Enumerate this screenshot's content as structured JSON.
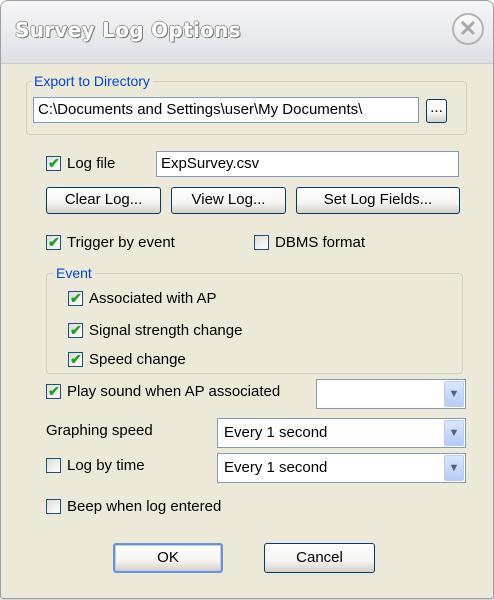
{
  "window": {
    "title": "Survey Log Options",
    "close_glyph": "✕"
  },
  "export": {
    "legend": "Export to Directory",
    "path": "C:\\Documents and Settings\\user\\My Documents\\",
    "browse_label": "..."
  },
  "log": {
    "log_file_label": "Log file",
    "log_file_checked": true,
    "file_name": "ExpSurvey.csv",
    "clear_label": "Clear Log...",
    "view_label": "View Log...",
    "fields_label": "Set Log Fields..."
  },
  "trigger": {
    "label": "Trigger by event",
    "checked": true
  },
  "dbms": {
    "label": "DBMS format",
    "checked": false
  },
  "event": {
    "legend": "Event",
    "items": [
      {
        "label": "Associated with AP",
        "checked": true
      },
      {
        "label": "Signal strength change",
        "checked": true
      },
      {
        "label": "Speed change",
        "checked": true
      }
    ]
  },
  "sound": {
    "label": "Play sound when AP associated",
    "checked": true,
    "value": ""
  },
  "graphing": {
    "label": "Graphing speed",
    "value": "Every 1 second"
  },
  "logtime": {
    "label": "Log by time",
    "checked": false,
    "value": "Every 1 second"
  },
  "beep": {
    "label": "Beep when log entered",
    "checked": false
  },
  "buttons": {
    "ok": "OK",
    "cancel": "Cancel"
  },
  "icons": {
    "check": "✔",
    "dropdown": "▼"
  },
  "colors": {
    "accent": "#0046d5",
    "check": "#21a121",
    "face": "#ece9d8"
  }
}
